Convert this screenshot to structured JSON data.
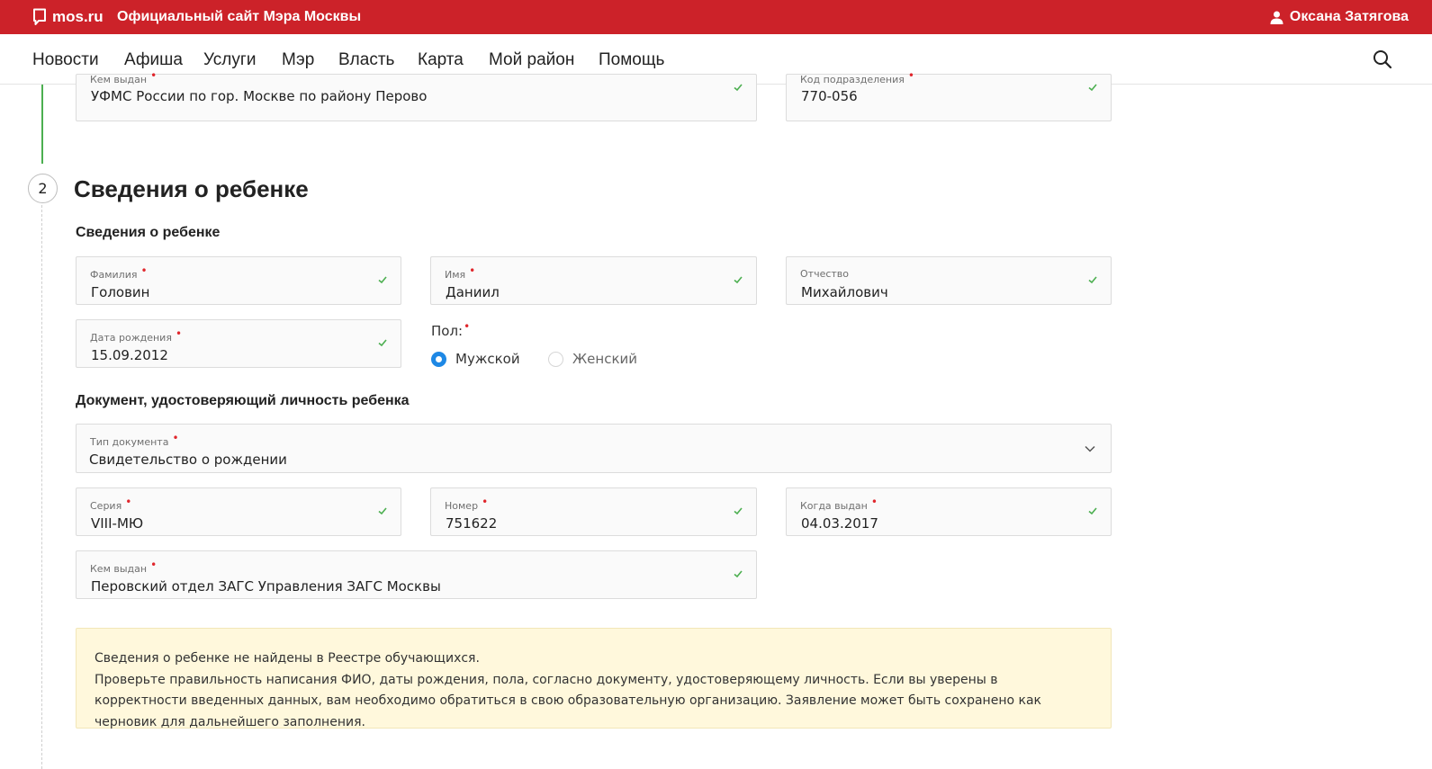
{
  "topbar": {
    "logo": "mos.ru",
    "site_title": "Официальный сайт Мэра Москвы",
    "user_name": "Оксана Затягова",
    "brand_color": "#cc2229"
  },
  "nav": {
    "items": [
      "Новости",
      "Афиша",
      "Услуги",
      "Мэр",
      "Власть",
      "Карта",
      "Мой район",
      "Помощь"
    ]
  },
  "parent_passport": {
    "issued_by": {
      "label": "Кем выдан",
      "value": "УФМС России по гор. Москве по району Перово"
    },
    "division_code": {
      "label": "Код подразделения",
      "value": "770-056"
    }
  },
  "step": {
    "number": "2",
    "title": "Сведения о ребенке"
  },
  "child": {
    "section_title": "Сведения о ребенке",
    "last_name": {
      "label": "Фамилия",
      "value": "Головин"
    },
    "first_name": {
      "label": "Имя",
      "value": "Даниил"
    },
    "patronymic": {
      "label": "Отчество",
      "value": "Михайлович"
    },
    "birth_date": {
      "label": "Дата рождения",
      "value": "15.09.2012"
    },
    "gender": {
      "label": "Пол:",
      "options": [
        "Мужской",
        "Женский"
      ],
      "selected": "Мужской"
    }
  },
  "document": {
    "section_title": "Документ, удостоверяющий личность ребенка",
    "type": {
      "label": "Тип документа",
      "value": "Свидетельство о рождении"
    },
    "series": {
      "label": "Серия",
      "value": "VIII-МЮ"
    },
    "number": {
      "label": "Номер",
      "value": "751622"
    },
    "issue_date": {
      "label": "Когда выдан",
      "value": "04.03.2017"
    },
    "issued_by": {
      "label": "Кем выдан",
      "value": "Перовский отдел ЗАГС Управления ЗАГС Москвы"
    }
  },
  "notice": {
    "line1": "Сведения о ребенке не найдены в Реестре обучающихся.",
    "line2": "Проверьте правильность написания ФИО, даты рождения, пола, согласно документу, удостоверяющему личность. Если вы уверены в корректности введенных данных, вам необходимо обратиться в свою образовательную организацию. Заявление может быть сохранено как черновик для дальнейшего заполнения."
  },
  "colors": {
    "valid_check": "#4caf50",
    "required_mark": "#e0262c",
    "radio_selected": "#1e88e5",
    "notice_bg": "#fff8dc"
  }
}
